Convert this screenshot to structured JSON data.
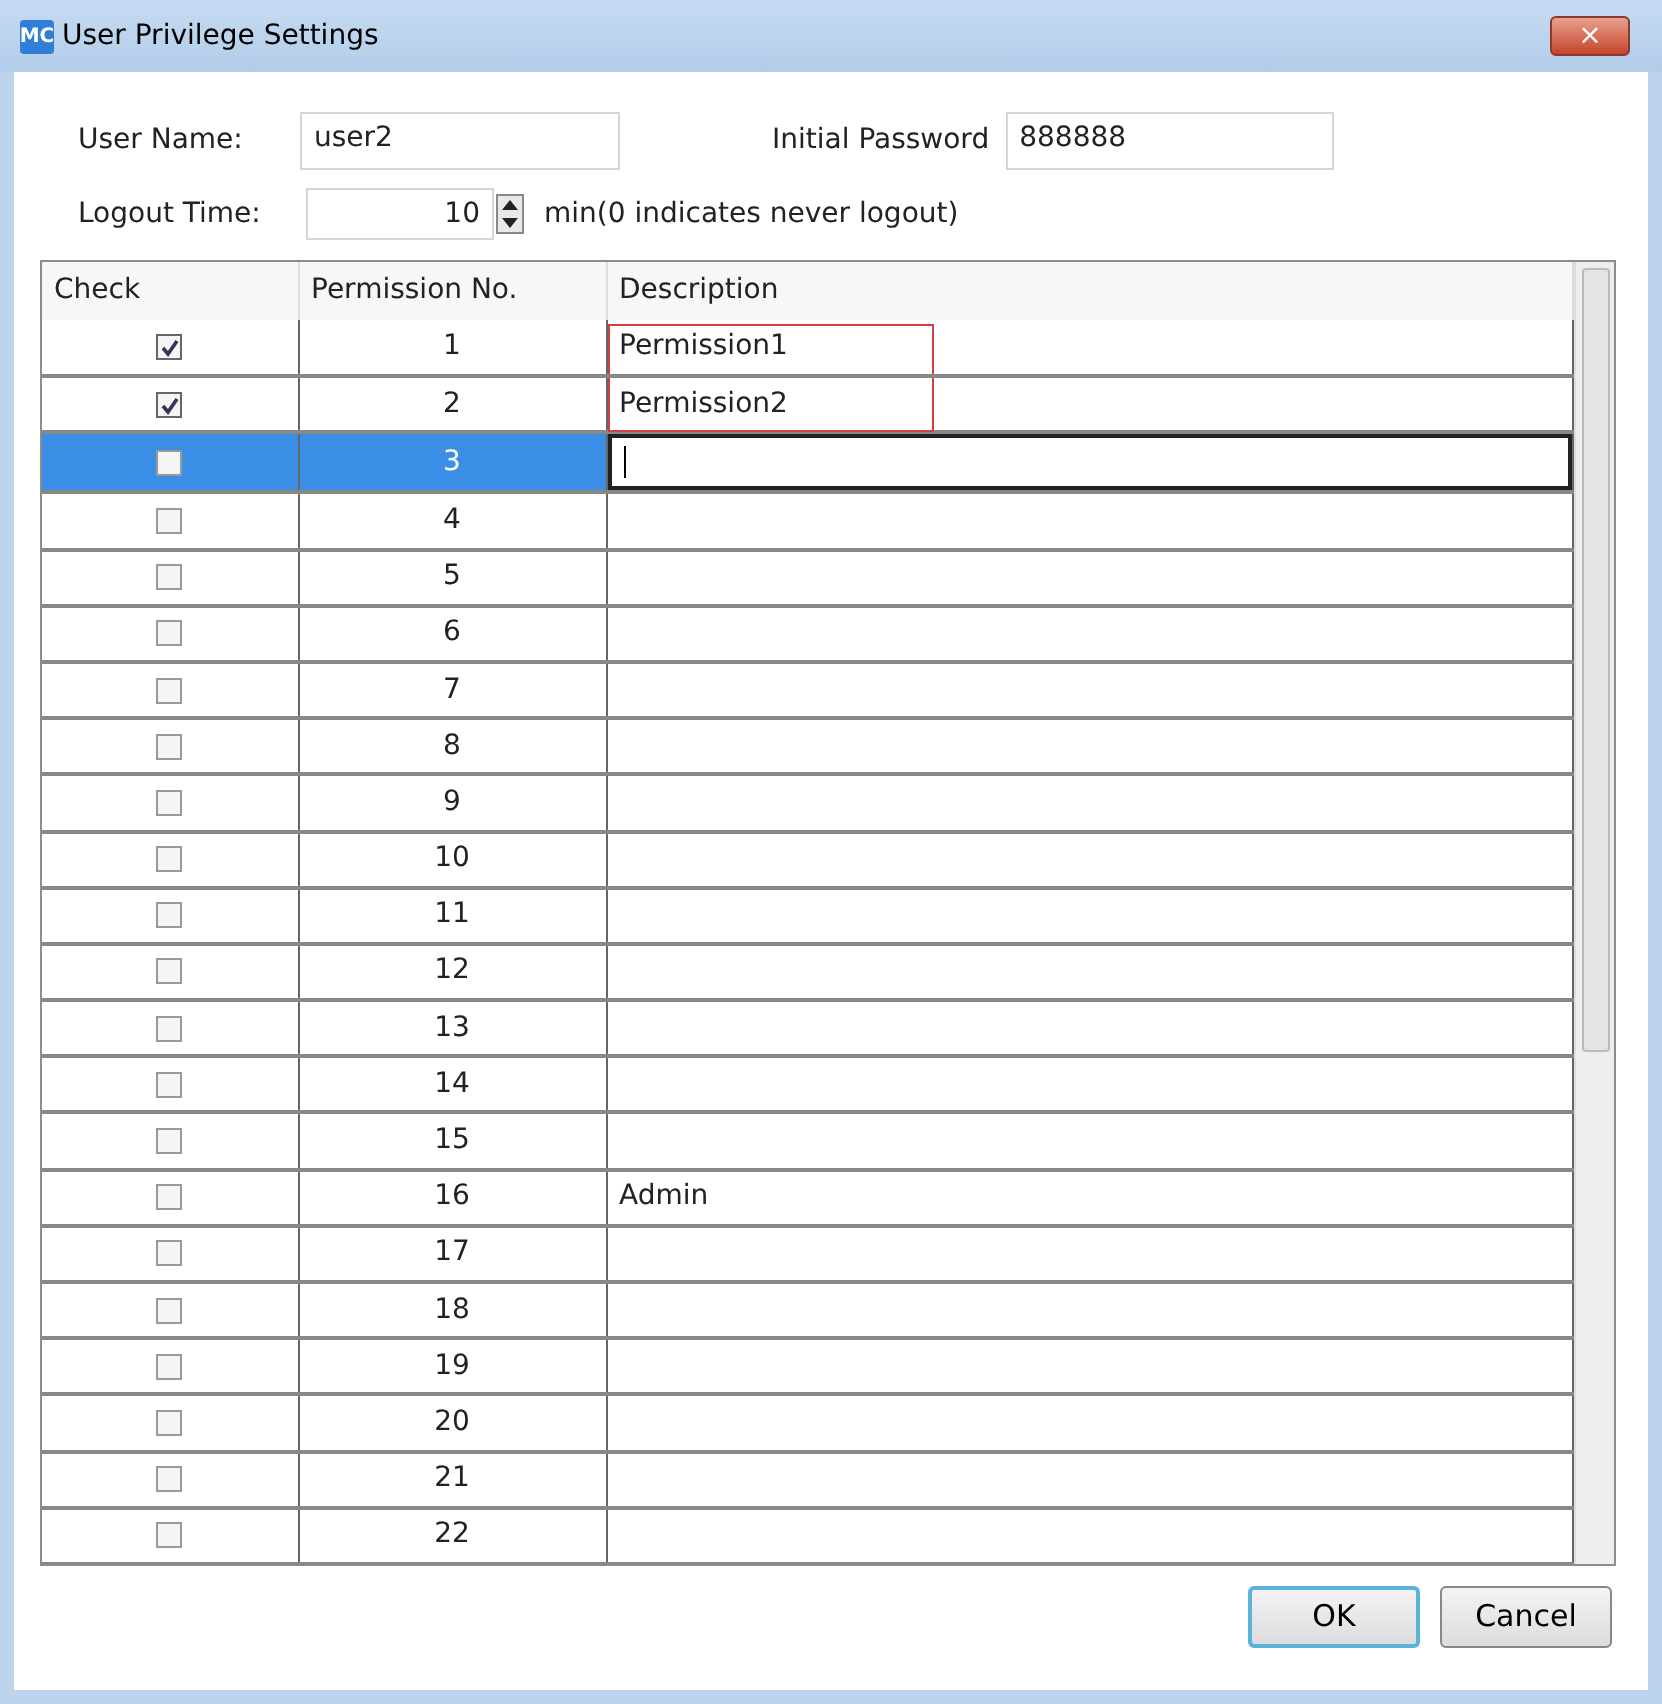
{
  "window": {
    "icon_text": "MC",
    "title": "User Privilege Settings",
    "close": "×"
  },
  "form": {
    "user_name_label": "User Name:",
    "user_name": "user2",
    "password_label": "Initial Password",
    "password": "888888",
    "logout_label": "Logout Time:",
    "logout_value": "10",
    "logout_hint": "min(0 indicates never logout)"
  },
  "table": {
    "columns": [
      "Check",
      "Permission No.",
      "Description"
    ],
    "rows": [
      {
        "checked": true,
        "number": "1",
        "description": "Permission1",
        "selected": false,
        "highlighted": true
      },
      {
        "checked": true,
        "number": "2",
        "description": "Permission2",
        "selected": false,
        "highlighted": true
      },
      {
        "checked": false,
        "number": "3",
        "selected": true,
        "highlighted": false
      },
      {
        "checked": false,
        "number": "4",
        "selected": false,
        "highlighted": false
      },
      {
        "checked": false,
        "number": "5",
        "selected": false,
        "highlighted": false
      },
      {
        "checked": false,
        "number": "6",
        "selected": false,
        "highlighted": false
      },
      {
        "checked": false,
        "number": "7",
        "selected": false,
        "highlighted": false
      },
      {
        "checked": false,
        "number": "8",
        "selected": false,
        "highlighted": false
      },
      {
        "checked": false,
        "number": "9",
        "selected": false,
        "highlighted": false
      },
      {
        "checked": false,
        "number": "10",
        "selected": false,
        "highlighted": false
      },
      {
        "checked": false,
        "number": "11",
        "selected": false,
        "highlighted": false
      },
      {
        "checked": false,
        "number": "12",
        "selected": false,
        "highlighted": false
      },
      {
        "checked": false,
        "number": "13",
        "selected": false,
        "highlighted": false
      },
      {
        "checked": false,
        "number": "14",
        "selected": false,
        "highlighted": false
      },
      {
        "checked": false,
        "number": "15",
        "selected": false,
        "highlighted": false
      },
      {
        "checked": false,
        "number": "16",
        "description": "Admin",
        "selected": false,
        "highlighted": false
      },
      {
        "checked": false,
        "number": "17",
        "selected": false,
        "highlighted": false
      },
      {
        "checked": false,
        "number": "18",
        "selected": false,
        "highlighted": false
      },
      {
        "checked": false,
        "number": "19",
        "selected": false,
        "highlighted": false
      },
      {
        "checked": false,
        "number": "20",
        "selected": false,
        "highlighted": false
      },
      {
        "checked": false,
        "number": "21",
        "selected": false,
        "highlighted": false
      },
      {
        "checked": false,
        "number": "22",
        "selected": false,
        "highlighted": false
      }
    ]
  },
  "buttons": [
    "OK",
    "Cancel"
  ]
}
